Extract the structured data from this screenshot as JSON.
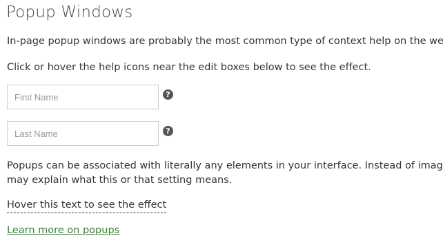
{
  "page": {
    "title": "Popup Windows",
    "intro_line_1": "In-page popup windows are probably the most common type of context help on the web.",
    "intro_line_2": "Click or hover the help icons near the edit boxes below to see the effect.",
    "description_line_1": "Popups can be associated with literally any elements in your interface. Instead of images c",
    "description_line_2": "may explain what this or that setting means.",
    "hover_text": "Hover this text to see the effect",
    "learn_more_link": "Learn more on popups"
  },
  "form": {
    "first_name": {
      "value": "",
      "placeholder": "First Name"
    },
    "last_name": {
      "value": "",
      "placeholder": "Last Name"
    }
  },
  "icons": {
    "help_icon_glyph": "?",
    "help_icon_name": "question-circle-icon"
  },
  "colors": {
    "link": "#2a8a2a",
    "text": "#333333",
    "icon": "#555555"
  }
}
